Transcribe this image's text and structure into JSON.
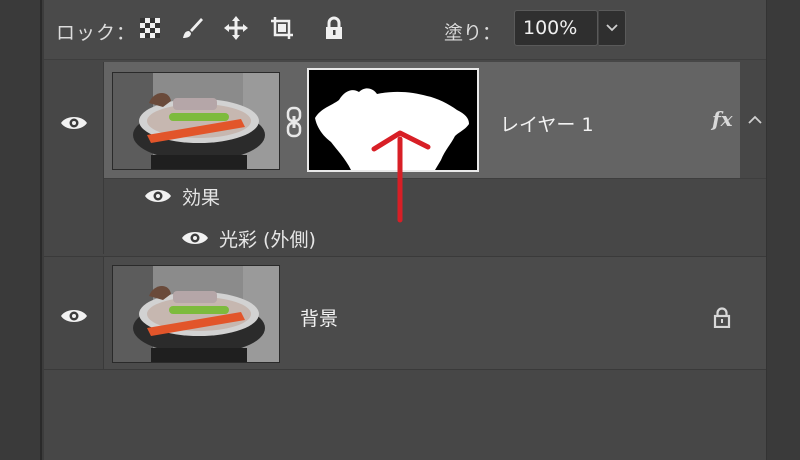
{
  "toolbar": {
    "lock_label": "ロック：",
    "fill_label": "塗り：",
    "fill_value": "100%",
    "lock_icons": [
      "transparency-lock-icon",
      "brush-lock-icon",
      "move-lock-icon",
      "artboard-lock-icon",
      "padlock-icon"
    ]
  },
  "layers": [
    {
      "name": "レイヤー 1",
      "has_mask": true,
      "fx_label": "fx",
      "effects_label": "効果",
      "effects": [
        {
          "name": "光彩 (外側)"
        }
      ]
    },
    {
      "name": "背景",
      "locked": true
    }
  ],
  "colors": {
    "panel": "#474747",
    "selected_row": "#646464",
    "arrow": "#d81f26"
  }
}
